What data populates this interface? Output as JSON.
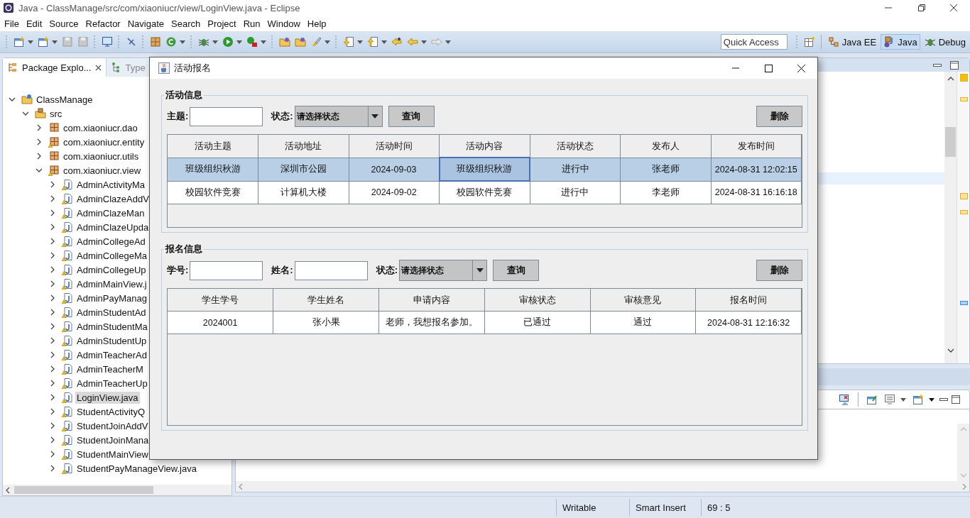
{
  "window": {
    "title": "Java - ClassManage/src/com/xiaoniucr/view/LoginView.java - Eclipse"
  },
  "menu": [
    "File",
    "Edit",
    "Source",
    "Refactor",
    "Navigate",
    "Search",
    "Project",
    "Run",
    "Window",
    "Help"
  ],
  "toolbar": {
    "quick_access": {
      "placeholder": "Quick Access"
    },
    "perspectives": [
      {
        "label": "Java EE",
        "kind": "javaee",
        "selected": false
      },
      {
        "label": "Java",
        "kind": "java",
        "selected": true
      },
      {
        "label": "Debug",
        "kind": "debug",
        "selected": false
      }
    ]
  },
  "package_explorer": {
    "tabs": [
      {
        "label": "Package Explo...",
        "kind": "packages",
        "selected": true,
        "closable": true
      },
      {
        "label": "Type",
        "kind": "hierarchy",
        "selected": false,
        "closable": false
      }
    ],
    "tree": [
      {
        "label": "ClassManage",
        "kind": "project",
        "expanded": true,
        "selected": false,
        "warning": false,
        "children": [
          {
            "label": "src",
            "kind": "source",
            "expanded": true,
            "selected": false,
            "warning": false,
            "children": [
              {
                "label": "com.xiaoniucr.dao",
                "kind": "package",
                "expanded": false,
                "selected": false,
                "warning": false
              },
              {
                "label": "com.xiaoniucr.entity",
                "kind": "package",
                "expanded": false,
                "selected": false,
                "warning": true
              },
              {
                "label": "com.xiaoniucr.utils",
                "kind": "package",
                "expanded": false,
                "selected": false,
                "warning": false
              },
              {
                "label": "com.xiaoniucr.view",
                "kind": "package",
                "expanded": true,
                "selected": false,
                "warning": true,
                "children": [
                  {
                    "label": "AdminActivityMa",
                    "kind": "file",
                    "expanded": false,
                    "selected": false,
                    "warning": true
                  },
                  {
                    "label": "AdminClazeAddV",
                    "kind": "file",
                    "expanded": false,
                    "selected": false,
                    "warning": true
                  },
                  {
                    "label": "AdminClazeMan",
                    "kind": "file",
                    "expanded": false,
                    "selected": false,
                    "warning": true
                  },
                  {
                    "label": "AdminClazeUpda",
                    "kind": "file",
                    "expanded": false,
                    "selected": false,
                    "warning": true
                  },
                  {
                    "label": "AdminCollegeAd",
                    "kind": "file",
                    "expanded": false,
                    "selected": false,
                    "warning": true
                  },
                  {
                    "label": "AdminCollegeMa",
                    "kind": "file",
                    "expanded": false,
                    "selected": false,
                    "warning": true
                  },
                  {
                    "label": "AdminCollegeUp",
                    "kind": "file",
                    "expanded": false,
                    "selected": false,
                    "warning": true
                  },
                  {
                    "label": "AdminMainView.j",
                    "kind": "file",
                    "expanded": false,
                    "selected": false,
                    "warning": true
                  },
                  {
                    "label": "AdminPayManag",
                    "kind": "file",
                    "expanded": false,
                    "selected": false,
                    "warning": true
                  },
                  {
                    "label": "AdminStudentAd",
                    "kind": "file",
                    "expanded": false,
                    "selected": false,
                    "warning": true
                  },
                  {
                    "label": "AdminStudentMa",
                    "kind": "file",
                    "expanded": false,
                    "selected": false,
                    "warning": true
                  },
                  {
                    "label": "AdminStudentUp",
                    "kind": "file",
                    "expanded": false,
                    "selected": false,
                    "warning": true
                  },
                  {
                    "label": "AdminTeacherAd",
                    "kind": "file",
                    "expanded": false,
                    "selected": false,
                    "warning": true
                  },
                  {
                    "label": "AdminTeacherM",
                    "kind": "file",
                    "expanded": false,
                    "selected": false,
                    "warning": true
                  },
                  {
                    "label": "AdminTeacherUp",
                    "kind": "file",
                    "expanded": false,
                    "selected": false,
                    "warning": true
                  },
                  {
                    "label": "LoginView.java",
                    "kind": "file",
                    "expanded": false,
                    "selected": true,
                    "warning": true
                  },
                  {
                    "label": "StudentActivityQ",
                    "kind": "file",
                    "expanded": false,
                    "selected": false,
                    "warning": true
                  },
                  {
                    "label": "StudentJoinAddV",
                    "kind": "file",
                    "expanded": false,
                    "selected": false,
                    "warning": true
                  },
                  {
                    "label": "StudentJoinMana",
                    "kind": "file",
                    "expanded": false,
                    "selected": false,
                    "warning": true
                  },
                  {
                    "label": "StudentMainView",
                    "kind": "file",
                    "expanded": false,
                    "selected": false,
                    "warning": true
                  },
                  {
                    "label": "StudentPayManageView.java",
                    "kind": "file",
                    "expanded": false,
                    "selected": false,
                    "warning": true
                  }
                ]
              }
            ]
          }
        ]
      }
    ]
  },
  "status_bar": {
    "items": [
      "Writable",
      "Smart Insert",
      "69 : 5"
    ]
  },
  "dialog": {
    "title": "活动报名",
    "activity": {
      "title": "活动信息",
      "filters": [
        {
          "kind": "text",
          "label": "主题:"
        },
        {
          "kind": "select",
          "label": "状态:",
          "value": "请选择状态"
        }
      ],
      "query_button": "查询",
      "delete_button": "删除",
      "columns": [
        "活动主题",
        "活动地址",
        "活动时间",
        "活动内容",
        "活动状态",
        "发布人",
        "发布时间"
      ],
      "rows": [
        {
          "selected": true,
          "cells": [
            {
              "text": "班级组织秋游",
              "focused": false
            },
            {
              "text": "深圳市公园",
              "focused": false
            },
            {
              "text": "2024-09-03",
              "focused": false
            },
            {
              "text": "班级组织秋游",
              "focused": true
            },
            {
              "text": "进行中",
              "focused": false
            },
            {
              "text": "张老师",
              "focused": false
            },
            {
              "text": "2024-08-31 12:02:15",
              "focused": false
            }
          ]
        },
        {
          "selected": false,
          "cells": [
            {
              "text": "校园软件竞赛",
              "focused": false
            },
            {
              "text": "计算机大楼",
              "focused": false
            },
            {
              "text": "2024-09-02",
              "focused": false
            },
            {
              "text": "校园软件竞赛",
              "focused": false
            },
            {
              "text": "进行中",
              "focused": false
            },
            {
              "text": "李老师",
              "focused": false
            },
            {
              "text": "2024-08-31 16:16:18",
              "focused": false
            }
          ]
        }
      ]
    },
    "signup": {
      "title": "报名信息",
      "filters": [
        {
          "kind": "text",
          "label": "学号:"
        },
        {
          "kind": "text",
          "label": "姓名:"
        },
        {
          "kind": "select",
          "label": "状态:",
          "value": "请选择状态"
        }
      ],
      "query_button": "查询",
      "delete_button": "删除",
      "columns": [
        "学生学号",
        "学生姓名",
        "申请内容",
        "审核状态",
        "审核意见",
        "报名时间"
      ],
      "rows": [
        {
          "selected": false,
          "cells": [
            {
              "text": "2024001",
              "focused": false
            },
            {
              "text": "张小果",
              "focused": false
            },
            {
              "text": "老师，我想报名参加。",
              "focused": false
            },
            {
              "text": "已通过",
              "focused": false
            },
            {
              "text": "通过",
              "focused": false
            },
            {
              "text": "2024-08-31 12:16:32",
              "focused": false
            }
          ]
        }
      ]
    }
  }
}
